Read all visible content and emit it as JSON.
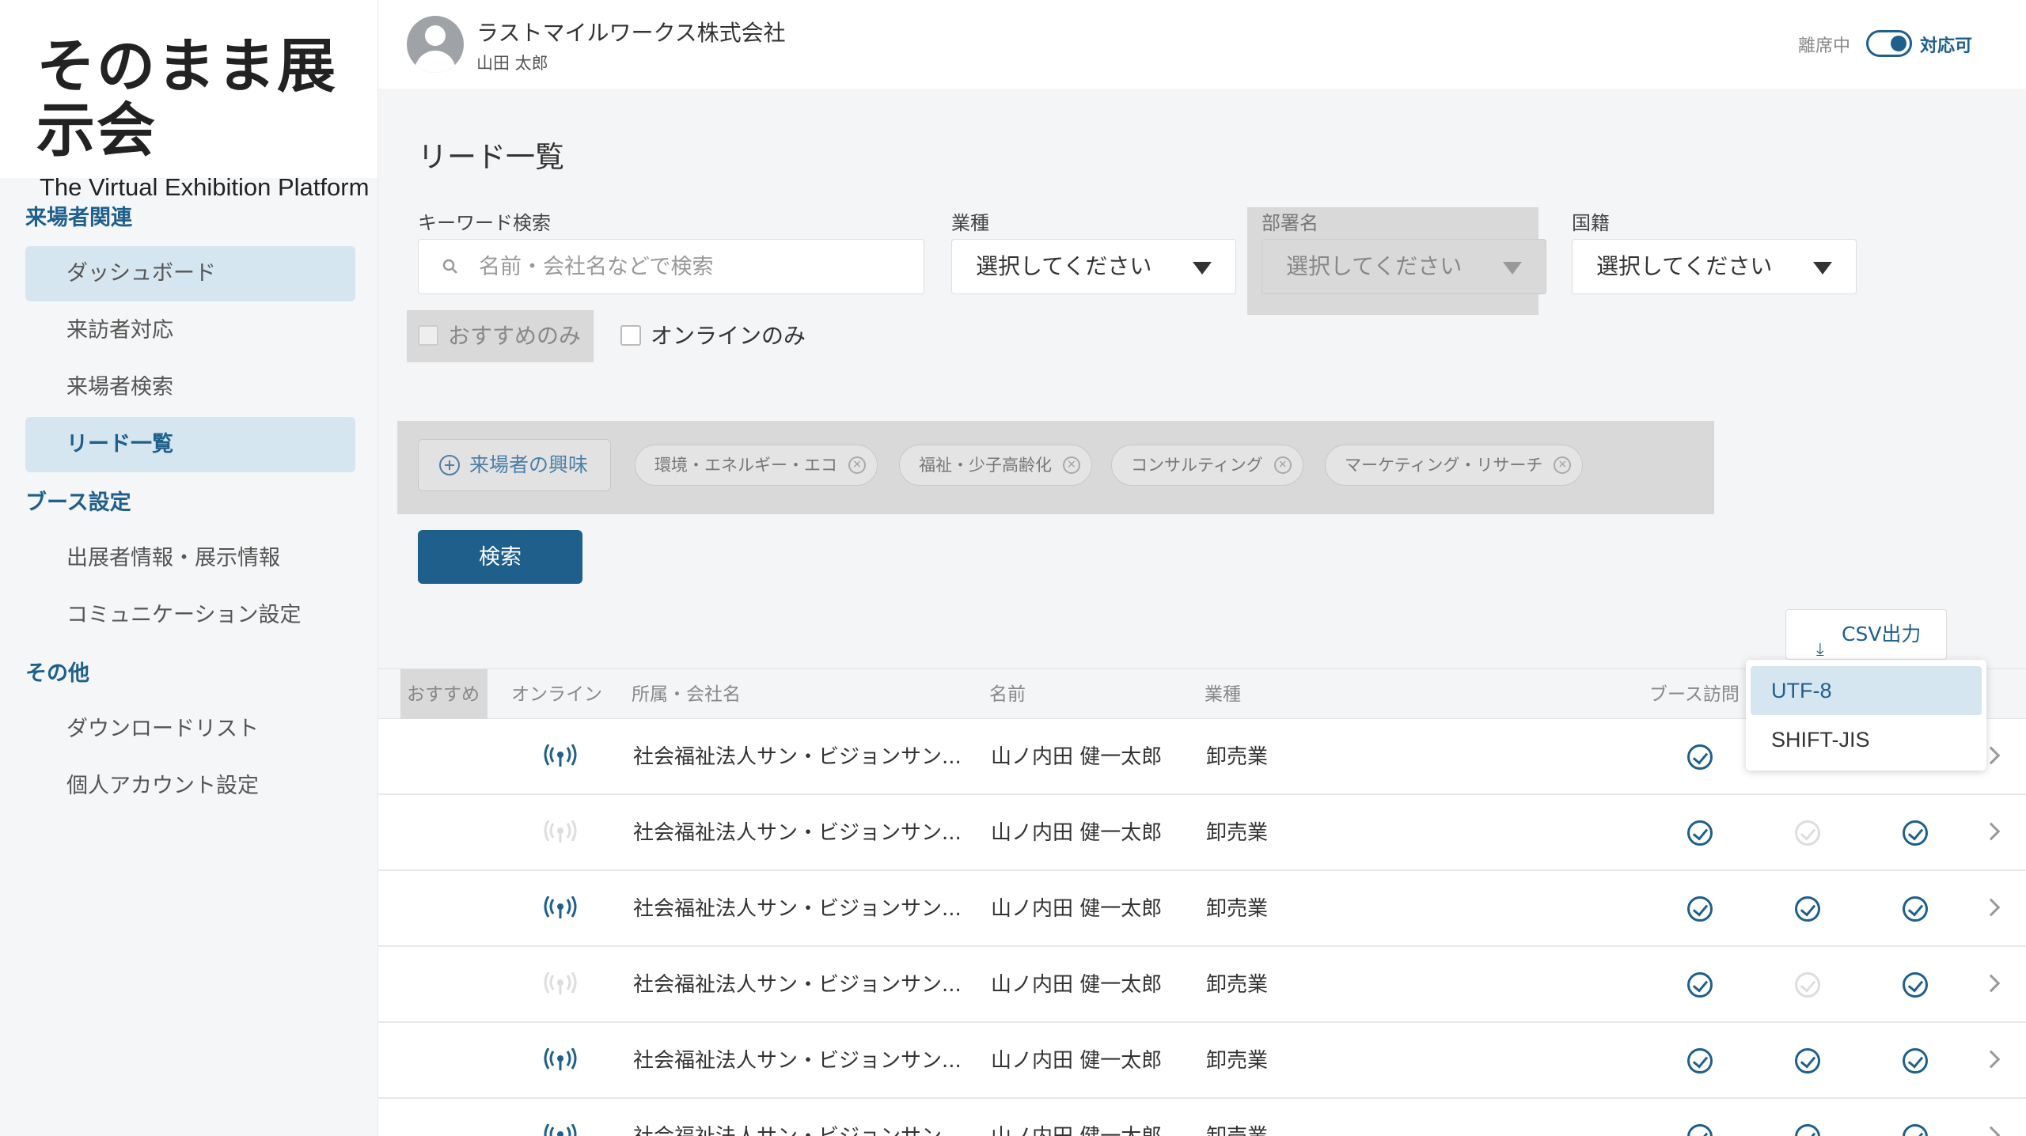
{
  "brand": {
    "title": "そのまま展示会",
    "subtitle": "The Virtual Exhibition Platform"
  },
  "sidebar": {
    "sections": [
      {
        "label": "来場者関連",
        "items": [
          {
            "label": "ダッシュボード"
          },
          {
            "label": "来訪者対応"
          },
          {
            "label": "来場者検索"
          },
          {
            "label": "リード一覧"
          }
        ]
      },
      {
        "label": "ブース設定",
        "items": [
          {
            "label": "出展者情報・展示情報"
          },
          {
            "label": "コミュニケーション設定"
          }
        ]
      },
      {
        "label": "その他",
        "items": [
          {
            "label": "ダウンロードリスト"
          },
          {
            "label": "個人アカウント設定"
          }
        ]
      }
    ]
  },
  "header": {
    "company": "ラストマイルワークス株式会社",
    "user": "山田 太郎",
    "status_off": "離席中",
    "status_on": "対応可"
  },
  "page": {
    "title": "リード一覧"
  },
  "filters": {
    "keyword_label": "キーワード検索",
    "keyword_placeholder": "名前・会社名などで検索",
    "industry_label": "業種",
    "industry_value": "選択してください",
    "dept_label": "部署名",
    "dept_value": "選択してください",
    "nationality_label": "国籍",
    "nationality_value": "選択してください",
    "recommend_only": "おすすめのみ",
    "online_only": "オンラインのみ",
    "interest_button": "来場者の興味",
    "tags": [
      "環境・エネルギー・エコ",
      "福祉・少子高齢化",
      "コンサルティング",
      "マーケティング・リサーチ"
    ],
    "search_button": "検索"
  },
  "csv": {
    "button": "CSV出力",
    "options": [
      "UTF-8",
      "SHIFT-JIS"
    ]
  },
  "table": {
    "headers": {
      "recommend": "おすすめ",
      "online": "オンライン",
      "company": "所属・会社名",
      "name": "名前",
      "industry": "業種",
      "booth": "ブース訪問"
    },
    "rows": [
      {
        "company": "社会福祉法人サン・ビジョンサン...",
        "name": "山ノ内田 健一太郎",
        "industry": "卸売業",
        "online": true,
        "checks": [
          true,
          true,
          true
        ]
      },
      {
        "company": "社会福祉法人サン・ビジョンサン...",
        "name": "山ノ内田 健一太郎",
        "industry": "卸売業",
        "online": false,
        "checks": [
          true,
          false,
          true
        ]
      },
      {
        "company": "社会福祉法人サン・ビジョンサン...",
        "name": "山ノ内田 健一太郎",
        "industry": "卸売業",
        "online": true,
        "checks": [
          true,
          true,
          true
        ]
      },
      {
        "company": "社会福祉法人サン・ビジョンサン...",
        "name": "山ノ内田 健一太郎",
        "industry": "卸売業",
        "online": false,
        "checks": [
          true,
          false,
          true
        ]
      },
      {
        "company": "社会福祉法人サン・ビジョンサン...",
        "name": "山ノ内田 健一太郎",
        "industry": "卸売業",
        "online": true,
        "checks": [
          true,
          true,
          true
        ]
      },
      {
        "company": "社会福祉法人サン・ビジョンサン...",
        "name": "山ノ内田 健一太郎",
        "industry": "卸売業",
        "online": true,
        "checks": [
          true,
          true,
          true
        ]
      }
    ]
  },
  "colors": {
    "accent": "#1e5f8c",
    "highlight": "#d6e6f1",
    "online_on": "#1e5f8c",
    "online_off": "#dddddd"
  }
}
